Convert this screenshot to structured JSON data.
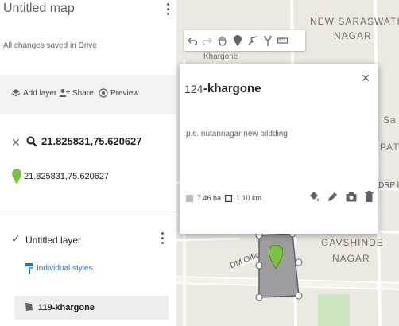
{
  "panel": {
    "map_title": "Untitled map",
    "save_status": "All changes saved in Drive",
    "toolbar": {
      "add_layer": "Add layer",
      "share": "Share",
      "preview": "Preview"
    },
    "search": {
      "query": "21.825831,75.620627",
      "result": "21.825831,75.620627"
    },
    "layer": {
      "name": "Untitled layer",
      "style_label": "Individual styles",
      "feature": "119-khargone"
    }
  },
  "map": {
    "labels": {
      "new_saraswati_1": "NEW SARASWATI",
      "new_saraswati_2": "NAGAR",
      "khargone": "Khargone",
      "gavshinde_1": "GAVSHINDE",
      "gavshinde_2": "NAGAR",
      "dm_office": "DM Office Rd",
      "edge_1": "Sa",
      "edge_2": "PAT",
      "edge_3": "DRP li"
    }
  },
  "popup": {
    "number": "124",
    "title": "-khargone",
    "description": "p.s. nutannagar new bildding",
    "area": "7.46 ha",
    "perimeter": "1.10 km"
  },
  "colors": {
    "marker_green": "#7cc242",
    "polygon_fill": "#9e9e9e",
    "link_blue": "#1a73e8"
  }
}
